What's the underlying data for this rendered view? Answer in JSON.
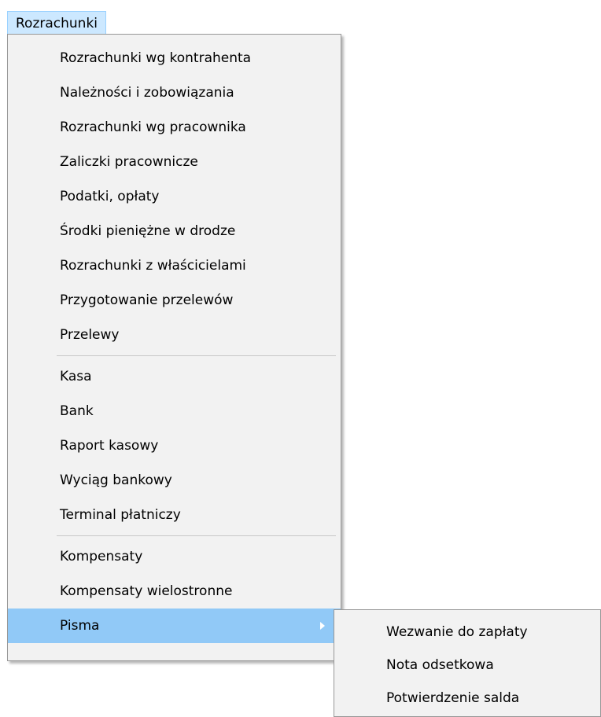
{
  "menubar": {
    "title": "Rozrachunki"
  },
  "menu": {
    "group1": [
      "Rozrachunki wg kontrahenta",
      "Należności i zobowiązania",
      "Rozrachunki wg pracownika",
      "Zaliczki pracownicze",
      "Podatki, opłaty",
      "Środki pieniężne w drodze",
      "Rozrachunki z właścicielami",
      "Przygotowanie przelewów",
      "Przelewy"
    ],
    "group2": [
      "Kasa",
      "Bank",
      "Raport kasowy",
      "Wyciąg bankowy",
      "Terminal płatniczy"
    ],
    "group3": [
      "Kompensaty",
      "Kompensaty wielostronne",
      "Pisma"
    ]
  },
  "submenu": {
    "items": [
      "Wezwanie do zapłaty",
      "Nota odsetkowa",
      "Potwierdzenie salda"
    ]
  },
  "colors": {
    "menu_background": "#f2f2f2",
    "highlight": "#91c9f7",
    "menubar_active": "#cce8ff",
    "border": "#979797"
  },
  "icons": {
    "submenu_indicator": "chevron-right-icon"
  }
}
